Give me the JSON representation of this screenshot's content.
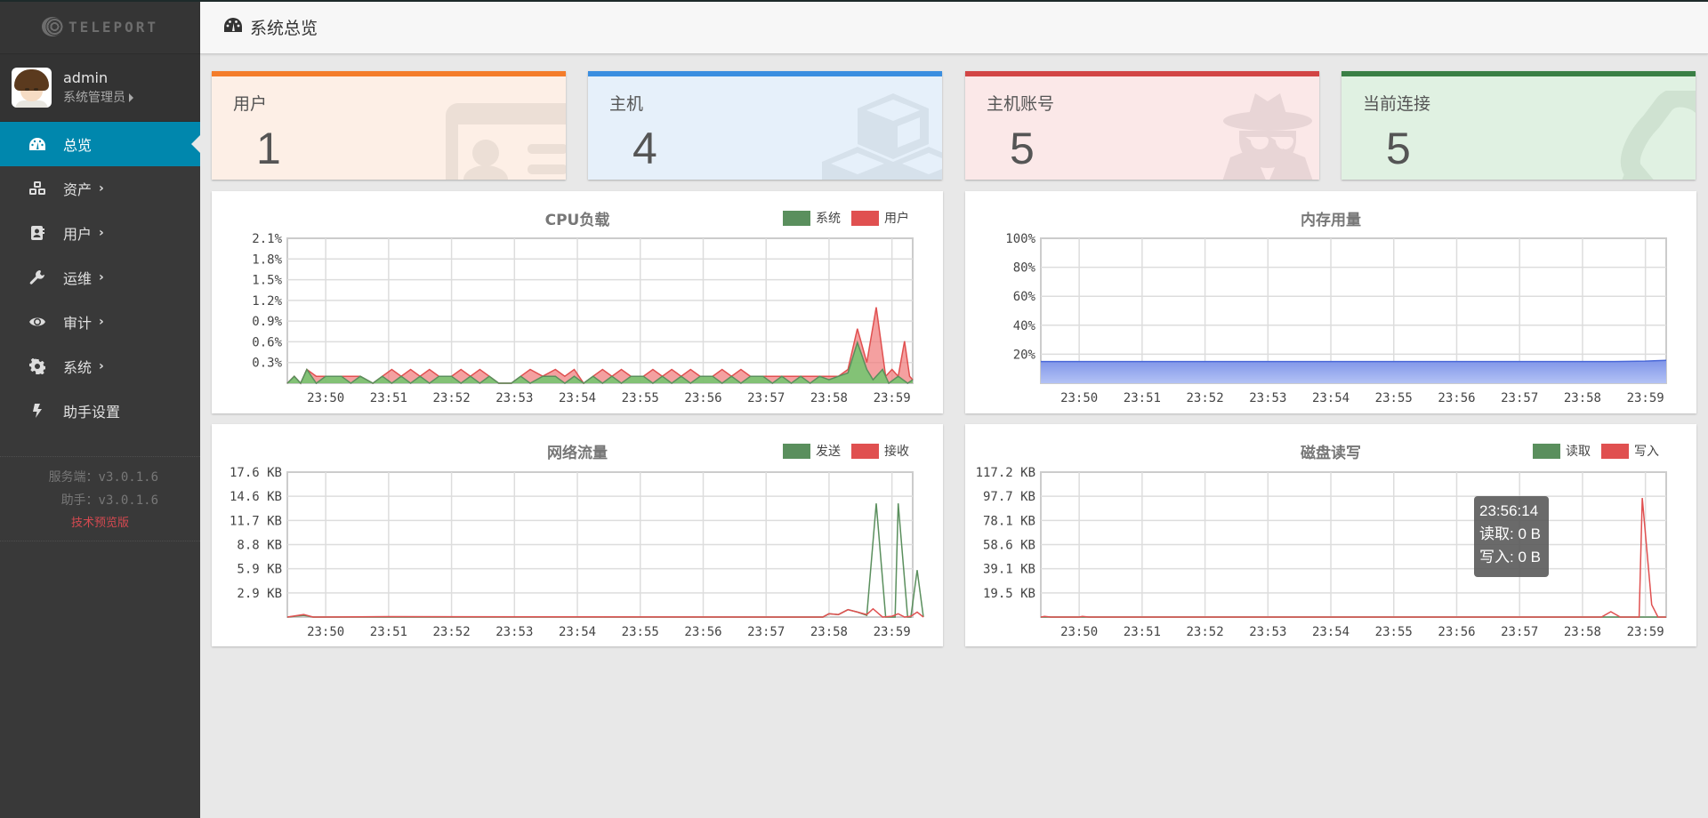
{
  "app": {
    "logo_text": "TELEPORT"
  },
  "user": {
    "name": "admin",
    "role": "系统管理员"
  },
  "sidebar": {
    "items": [
      {
        "label": "总览",
        "icon": "dashboard-icon",
        "active": true,
        "has_submenu": false
      },
      {
        "label": "资产",
        "icon": "cubes-icon",
        "active": false,
        "has_submenu": true
      },
      {
        "label": "用户",
        "icon": "address-book-icon",
        "active": false,
        "has_submenu": true
      },
      {
        "label": "运维",
        "icon": "wrench-icon",
        "active": false,
        "has_submenu": true
      },
      {
        "label": "审计",
        "icon": "eye-icon",
        "active": false,
        "has_submenu": true
      },
      {
        "label": "系统",
        "icon": "gear-icon",
        "active": false,
        "has_submenu": true
      },
      {
        "label": "助手设置",
        "icon": "bolt-icon",
        "active": false,
        "has_submenu": false
      }
    ],
    "chevron": "›",
    "version_server": "服务端：v3.0.1.6",
    "version_assist": "助手：v3.0.1.6",
    "preview_label": "技术预览版"
  },
  "header": {
    "title": "系统总览",
    "icon": "dashboard-icon"
  },
  "stats": [
    {
      "label": "用户",
      "value": "1",
      "accent": "#f47c2a",
      "bg": "#fdefe6",
      "icon": "id-card-icon"
    },
    {
      "label": "主机",
      "value": "4",
      "accent": "#3a8ee0",
      "bg": "#e6f0fa",
      "icon": "cubes-icon"
    },
    {
      "label": "主机账号",
      "value": "5",
      "accent": "#d24545",
      "bg": "#fbe8e8",
      "icon": "user-secret-icon"
    },
    {
      "label": "当前连接",
      "value": "5",
      "accent": "#3a7f45",
      "bg": "#e0f1e2",
      "icon": "link-icon"
    }
  ],
  "colors": {
    "series_green": "#5a8f5d",
    "series_red": "#e05050",
    "memory_blue": "#4a68d8",
    "active_menu": "#0087ad"
  },
  "tooltip": {
    "time": "23:56:14",
    "line1": "读取: 0 B",
    "line2": "写入: 0 B"
  },
  "chart_data": [
    {
      "id": "cpu",
      "type": "area",
      "title": "CPU负载",
      "legend": [
        {
          "name": "系统",
          "color": "#5a8f5d"
        },
        {
          "name": "用户",
          "color": "#e05050"
        }
      ],
      "legend_position": "top-right",
      "x_ticks": [
        "23:50",
        "23:51",
        "23:52",
        "23:53",
        "23:54",
        "23:55",
        "23:56",
        "23:57",
        "23:58",
        "23:59"
      ],
      "x_range_minutes": [
        -0.61,
        9.33
      ],
      "y_ticks": [
        "0.3%",
        "0.6%",
        "0.9%",
        "1.2%",
        "1.5%",
        "1.8%",
        "2.1%"
      ],
      "ylim": [
        0,
        2.1
      ],
      "grid": true,
      "series": [
        {
          "name": "系统",
          "points": [
            [
              -0.61,
              0
            ],
            [
              -0.5,
              0.1
            ],
            [
              -0.4,
              0
            ],
            [
              -0.3,
              0.2
            ],
            [
              -0.15,
              0
            ],
            [
              0,
              0.1
            ],
            [
              0.25,
              0.1
            ],
            [
              0.4,
              0
            ],
            [
              0.55,
              0.1
            ],
            [
              0.75,
              0
            ],
            [
              0.9,
              0.1
            ],
            [
              1.05,
              0
            ],
            [
              1.2,
              0.1
            ],
            [
              1.35,
              0
            ],
            [
              1.5,
              0.1
            ],
            [
              1.65,
              0
            ],
            [
              1.8,
              0.1
            ],
            [
              2.0,
              0.1
            ],
            [
              2.15,
              0
            ],
            [
              2.3,
              0.1
            ],
            [
              2.45,
              0
            ],
            [
              2.6,
              0.1
            ],
            [
              2.75,
              0
            ],
            [
              2.95,
              0
            ],
            [
              3.1,
              0.1
            ],
            [
              3.25,
              0
            ],
            [
              3.45,
              0.1
            ],
            [
              3.65,
              0.1
            ],
            [
              3.8,
              0
            ],
            [
              3.95,
              0.1
            ],
            [
              4.1,
              0
            ],
            [
              4.25,
              0.1
            ],
            [
              4.4,
              0
            ],
            [
              4.55,
              0.1
            ],
            [
              4.7,
              0
            ],
            [
              4.85,
              0.1
            ],
            [
              5.05,
              0.1
            ],
            [
              5.2,
              0
            ],
            [
              5.35,
              0.1
            ],
            [
              5.5,
              0
            ],
            [
              5.65,
              0.1
            ],
            [
              5.8,
              0
            ],
            [
              5.95,
              0.1
            ],
            [
              6.15,
              0.1
            ],
            [
              6.3,
              0
            ],
            [
              6.45,
              0.1
            ],
            [
              6.6,
              0
            ],
            [
              6.75,
              0.1
            ],
            [
              6.95,
              0.1
            ],
            [
              7.1,
              0
            ],
            [
              7.25,
              0.1
            ],
            [
              7.4,
              0
            ],
            [
              7.55,
              0.1
            ],
            [
              7.7,
              0
            ],
            [
              7.85,
              0.1
            ],
            [
              8.0,
              0.05
            ],
            [
              8.15,
              0.1
            ],
            [
              8.3,
              0.15
            ],
            [
              8.45,
              0.59
            ],
            [
              8.6,
              0.2
            ],
            [
              8.7,
              0.05
            ],
            [
              8.85,
              0.2
            ],
            [
              8.95,
              0
            ],
            [
              9.1,
              0.1
            ],
            [
              9.25,
              0
            ],
            [
              9.33,
              0.05
            ]
          ]
        },
        {
          "name": "用户",
          "points": [
            [
              -0.61,
              0
            ],
            [
              -0.5,
              0.1
            ],
            [
              -0.4,
              0
            ],
            [
              -0.3,
              0.2
            ],
            [
              -0.15,
              0.1
            ],
            [
              0,
              0.1
            ],
            [
              0.25,
              0.1
            ],
            [
              0.4,
              0.1
            ],
            [
              0.55,
              0.1
            ],
            [
              0.75,
              0
            ],
            [
              0.9,
              0.1
            ],
            [
              1.05,
              0.2
            ],
            [
              1.2,
              0.1
            ],
            [
              1.35,
              0.2
            ],
            [
              1.5,
              0.1
            ],
            [
              1.65,
              0.2
            ],
            [
              1.8,
              0.1
            ],
            [
              2.0,
              0.1
            ],
            [
              2.15,
              0.2
            ],
            [
              2.3,
              0.1
            ],
            [
              2.45,
              0.2
            ],
            [
              2.6,
              0.1
            ],
            [
              2.75,
              0
            ],
            [
              2.95,
              0
            ],
            [
              3.1,
              0.1
            ],
            [
              3.25,
              0.2
            ],
            [
              3.45,
              0.1
            ],
            [
              3.65,
              0.2
            ],
            [
              3.8,
              0.1
            ],
            [
              3.95,
              0.2
            ],
            [
              4.1,
              0
            ],
            [
              4.25,
              0.1
            ],
            [
              4.4,
              0.2
            ],
            [
              4.55,
              0.1
            ],
            [
              4.7,
              0.2
            ],
            [
              4.85,
              0.1
            ],
            [
              5.05,
              0.1
            ],
            [
              5.2,
              0.2
            ],
            [
              5.35,
              0.1
            ],
            [
              5.5,
              0.2
            ],
            [
              5.65,
              0.1
            ],
            [
              5.8,
              0.2
            ],
            [
              5.95,
              0.1
            ],
            [
              6.15,
              0.1
            ],
            [
              6.3,
              0.2
            ],
            [
              6.45,
              0.1
            ],
            [
              6.6,
              0.2
            ],
            [
              6.75,
              0.1
            ],
            [
              6.95,
              0.1
            ],
            [
              7.1,
              0.1
            ],
            [
              7.25,
              0.1
            ],
            [
              7.4,
              0.1
            ],
            [
              7.55,
              0.1
            ],
            [
              7.7,
              0.1
            ],
            [
              7.85,
              0.1
            ],
            [
              8.0,
              0.1
            ],
            [
              8.15,
              0.1
            ],
            [
              8.3,
              0.2
            ],
            [
              8.45,
              0.79
            ],
            [
              8.6,
              0.3
            ],
            [
              8.75,
              1.1
            ],
            [
              8.9,
              0.1
            ],
            [
              9.0,
              0.2
            ],
            [
              9.1,
              0.1
            ],
            [
              9.2,
              0.61
            ],
            [
              9.28,
              0.1
            ],
            [
              9.33,
              0.05
            ]
          ]
        }
      ]
    },
    {
      "id": "memory",
      "type": "area",
      "title": "内存用量",
      "legend": [],
      "x_ticks": [
        "23:50",
        "23:51",
        "23:52",
        "23:53",
        "23:54",
        "23:55",
        "23:56",
        "23:57",
        "23:58",
        "23:59"
      ],
      "x_range_minutes": [
        -0.61,
        9.33
      ],
      "y_ticks": [
        "20%",
        "40%",
        "60%",
        "80%",
        "100%"
      ],
      "ylim": [
        0,
        100
      ],
      "grid": true,
      "series": [
        {
          "name": "内存",
          "points": [
            [
              -0.61,
              15
            ],
            [
              8.5,
              15
            ],
            [
              9.0,
              15.3
            ],
            [
              9.33,
              15.8
            ]
          ]
        }
      ]
    },
    {
      "id": "network",
      "type": "line",
      "title": "网络流量",
      "legend": [
        {
          "name": "发送",
          "color": "#5a8f5d"
        },
        {
          "name": "接收",
          "color": "#e05050"
        }
      ],
      "legend_position": "top-right",
      "x_ticks": [
        "23:50",
        "23:51",
        "23:52",
        "23:53",
        "23:54",
        "23:55",
        "23:56",
        "23:57",
        "23:58",
        "23:59"
      ],
      "x_range_minutes": [
        -0.61,
        9.33
      ],
      "y_ticks": [
        "2.9 KB",
        "5.9 KB",
        "8.8 KB",
        "11.7 KB",
        "14.6 KB",
        "17.6 KB"
      ],
      "ylim": [
        0,
        17.6
      ],
      "grid": true,
      "series": [
        {
          "name": "发送",
          "points": [
            [
              -0.61,
              0
            ],
            [
              -0.35,
              0.2
            ],
            [
              -0.2,
              0
            ],
            [
              7.9,
              0
            ],
            [
              8.0,
              0.4
            ],
            [
              8.15,
              0.3
            ],
            [
              8.3,
              0.9
            ],
            [
              8.45,
              0.6
            ],
            [
              8.6,
              0.2
            ],
            [
              8.75,
              13.8
            ],
            [
              8.9,
              0
            ],
            [
              9.05,
              0
            ],
            [
              9.1,
              13.8
            ],
            [
              9.25,
              0
            ],
            [
              9.3,
              0
            ],
            [
              9.4,
              5.7
            ],
            [
              9.5,
              0
            ]
          ]
        },
        {
          "name": "接收",
          "points": [
            [
              -0.61,
              0
            ],
            [
              -0.35,
              0.3
            ],
            [
              -0.2,
              0
            ],
            [
              1.0,
              0.05
            ],
            [
              7.9,
              0
            ],
            [
              8.0,
              0.4
            ],
            [
              8.15,
              0.3
            ],
            [
              8.3,
              0.9
            ],
            [
              8.45,
              0.6
            ],
            [
              8.6,
              0.3
            ],
            [
              8.7,
              1.0
            ],
            [
              8.85,
              0
            ],
            [
              9.0,
              0.1
            ],
            [
              9.1,
              0.4
            ],
            [
              9.2,
              0
            ],
            [
              9.3,
              0.1
            ],
            [
              9.4,
              0.6
            ],
            [
              9.5,
              0
            ]
          ]
        }
      ]
    },
    {
      "id": "disk",
      "type": "line",
      "title": "磁盘读写",
      "legend": [
        {
          "name": "读取",
          "color": "#5a8f5d"
        },
        {
          "name": "写入",
          "color": "#e05050"
        }
      ],
      "legend_position": "top-right",
      "x_ticks": [
        "23:50",
        "23:51",
        "23:52",
        "23:53",
        "23:54",
        "23:55",
        "23:56",
        "23:57",
        "23:58",
        "23:59"
      ],
      "x_range_minutes": [
        -0.61,
        9.33
      ],
      "y_ticks": [
        "19.5 KB",
        "39.1 KB",
        "58.6 KB",
        "78.1 KB",
        "97.7 KB",
        "117.2 KB"
      ],
      "ylim": [
        0,
        117.2
      ],
      "grid": true,
      "series": [
        {
          "name": "读取",
          "points": [
            [
              -0.61,
              0
            ],
            [
              9.33,
              0
            ]
          ]
        },
        {
          "name": "写入",
          "points": [
            [
              -0.61,
              0
            ],
            [
              -0.55,
              0.5
            ],
            [
              -0.45,
              0
            ],
            [
              0,
              0
            ],
            [
              0.05,
              0.5
            ],
            [
              0.15,
              0
            ],
            [
              8.3,
              0
            ],
            [
              8.45,
              4.3
            ],
            [
              8.6,
              0
            ],
            [
              8.9,
              0
            ],
            [
              8.95,
              96.3
            ],
            [
              9.1,
              10
            ],
            [
              9.2,
              0
            ],
            [
              9.33,
              0
            ]
          ]
        }
      ]
    }
  ]
}
